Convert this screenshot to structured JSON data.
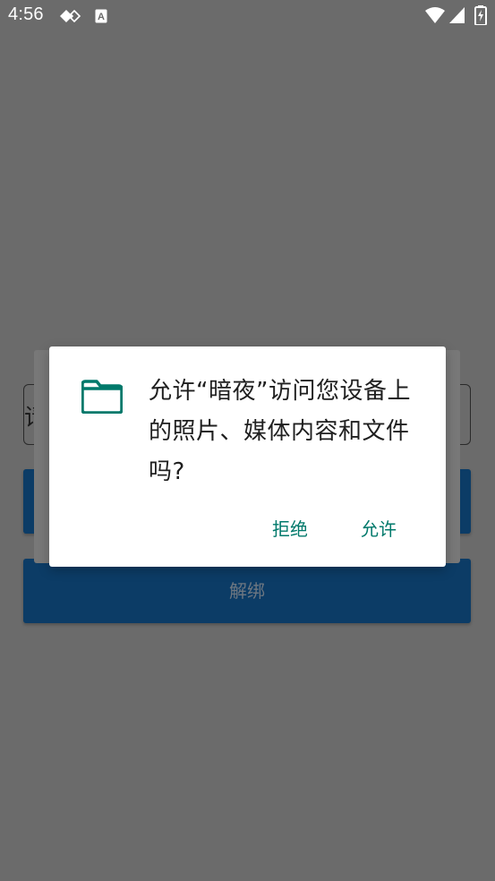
{
  "status_bar": {
    "time": "4:56",
    "icons": [
      "diamond-nav-icon",
      "a-box-icon",
      "wifi-icon",
      "signal-icon",
      "battery-charging-icon"
    ]
  },
  "background": {
    "input_partial_text": "请",
    "button_top_label": "",
    "button_bottom_label": "解绑"
  },
  "dialog": {
    "icon": "folder-icon",
    "message": "允许“暗夜”访问您设备上的照片、媒体内容和文件吗?",
    "deny_label": "拒绝",
    "allow_label": "允许",
    "accent_color": "#00796b"
  }
}
